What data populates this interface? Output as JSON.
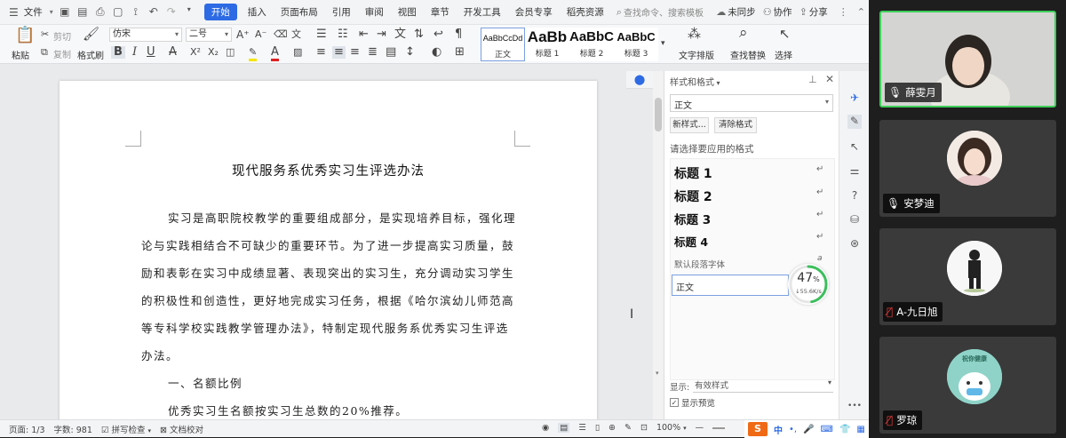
{
  "menubar": {
    "file": "文件",
    "tabs": [
      "开始",
      "插入",
      "页面布局",
      "引用",
      "审阅",
      "视图",
      "章节",
      "开发工具",
      "会员专享",
      "稻壳资源"
    ],
    "active_tab": "开始",
    "search_placeholder": "查找命令、搜索模板",
    "sync": "未同步",
    "collab": "协作",
    "share": "分享"
  },
  "ribbon": {
    "paste": "粘贴",
    "cut": "剪切",
    "copy": "复制",
    "format_painter": "格式刷",
    "font_name": "仿宋",
    "font_size": "二号",
    "styles": [
      {
        "preview": "AaBbCcDd",
        "label": "正文"
      },
      {
        "preview": "AaBb",
        "label": "标题 1"
      },
      {
        "preview": "AaBbC",
        "label": "标题 2"
      },
      {
        "preview": "AaBbC",
        "label": "标题 3"
      }
    ],
    "text_layout": "文字排版",
    "find_replace": "查找替换",
    "select": "选择"
  },
  "document": {
    "title": "现代服务系优秀实习生评选办法",
    "lines": [
      "实习是高职院校教学的重要组成部分，是实现培养目标，强化理",
      "论与实践相结合不可缺少的重要环节。为了进一步提高实习质量，鼓",
      "励和表彰在实习中成绩显著、表现突出的实习生，充分调动实习学生",
      "的积极性和创造性，更好地完成实习任务，根据《哈尔滨幼儿师范高",
      "等专科学校实践教学管理办法》，特制定现代服务系优秀实习生评选",
      "办法。",
      "一、名额比例",
      "优秀实习生名额按实习生总数的20%推荐。"
    ]
  },
  "style_panel": {
    "header": "样式和格式",
    "current_style": "正文",
    "new_style": "新样式...",
    "clear_format": "清除格式",
    "apply_prompt": "请选择要应用的格式",
    "headings": [
      "标题 1",
      "标题 2",
      "标题 3",
      "标题 4"
    ],
    "default_font": "默认段落字体",
    "normal": "正文",
    "progress_percent": 47,
    "speed": "55.6K/s",
    "show_label": "显示:",
    "show_value": "有效样式",
    "preview_checkbox": "显示预览"
  },
  "statusbar": {
    "page": "页面: 1/3",
    "word_count": "字数: 981",
    "spell_check": "拼写检查",
    "doc_check": "文档校对",
    "zoom": "100%",
    "ime": "中"
  },
  "meeting": {
    "participants": [
      {
        "name": "薛雯月",
        "mic": "on",
        "active": true
      },
      {
        "name": "安梦迪",
        "mic": "on",
        "active": false
      },
      {
        "name": "A-九日旭",
        "mic": "muted",
        "active": false
      },
      {
        "name": "罗琼",
        "mic": "muted",
        "active": false
      }
    ],
    "avatar4_text": "祝你健康",
    "more": "•••"
  },
  "colors": {
    "accent": "#2d6be4",
    "active_speaker": "#3ecf5a",
    "muted": "#e23b3b",
    "progress": "#3cbf5d"
  }
}
